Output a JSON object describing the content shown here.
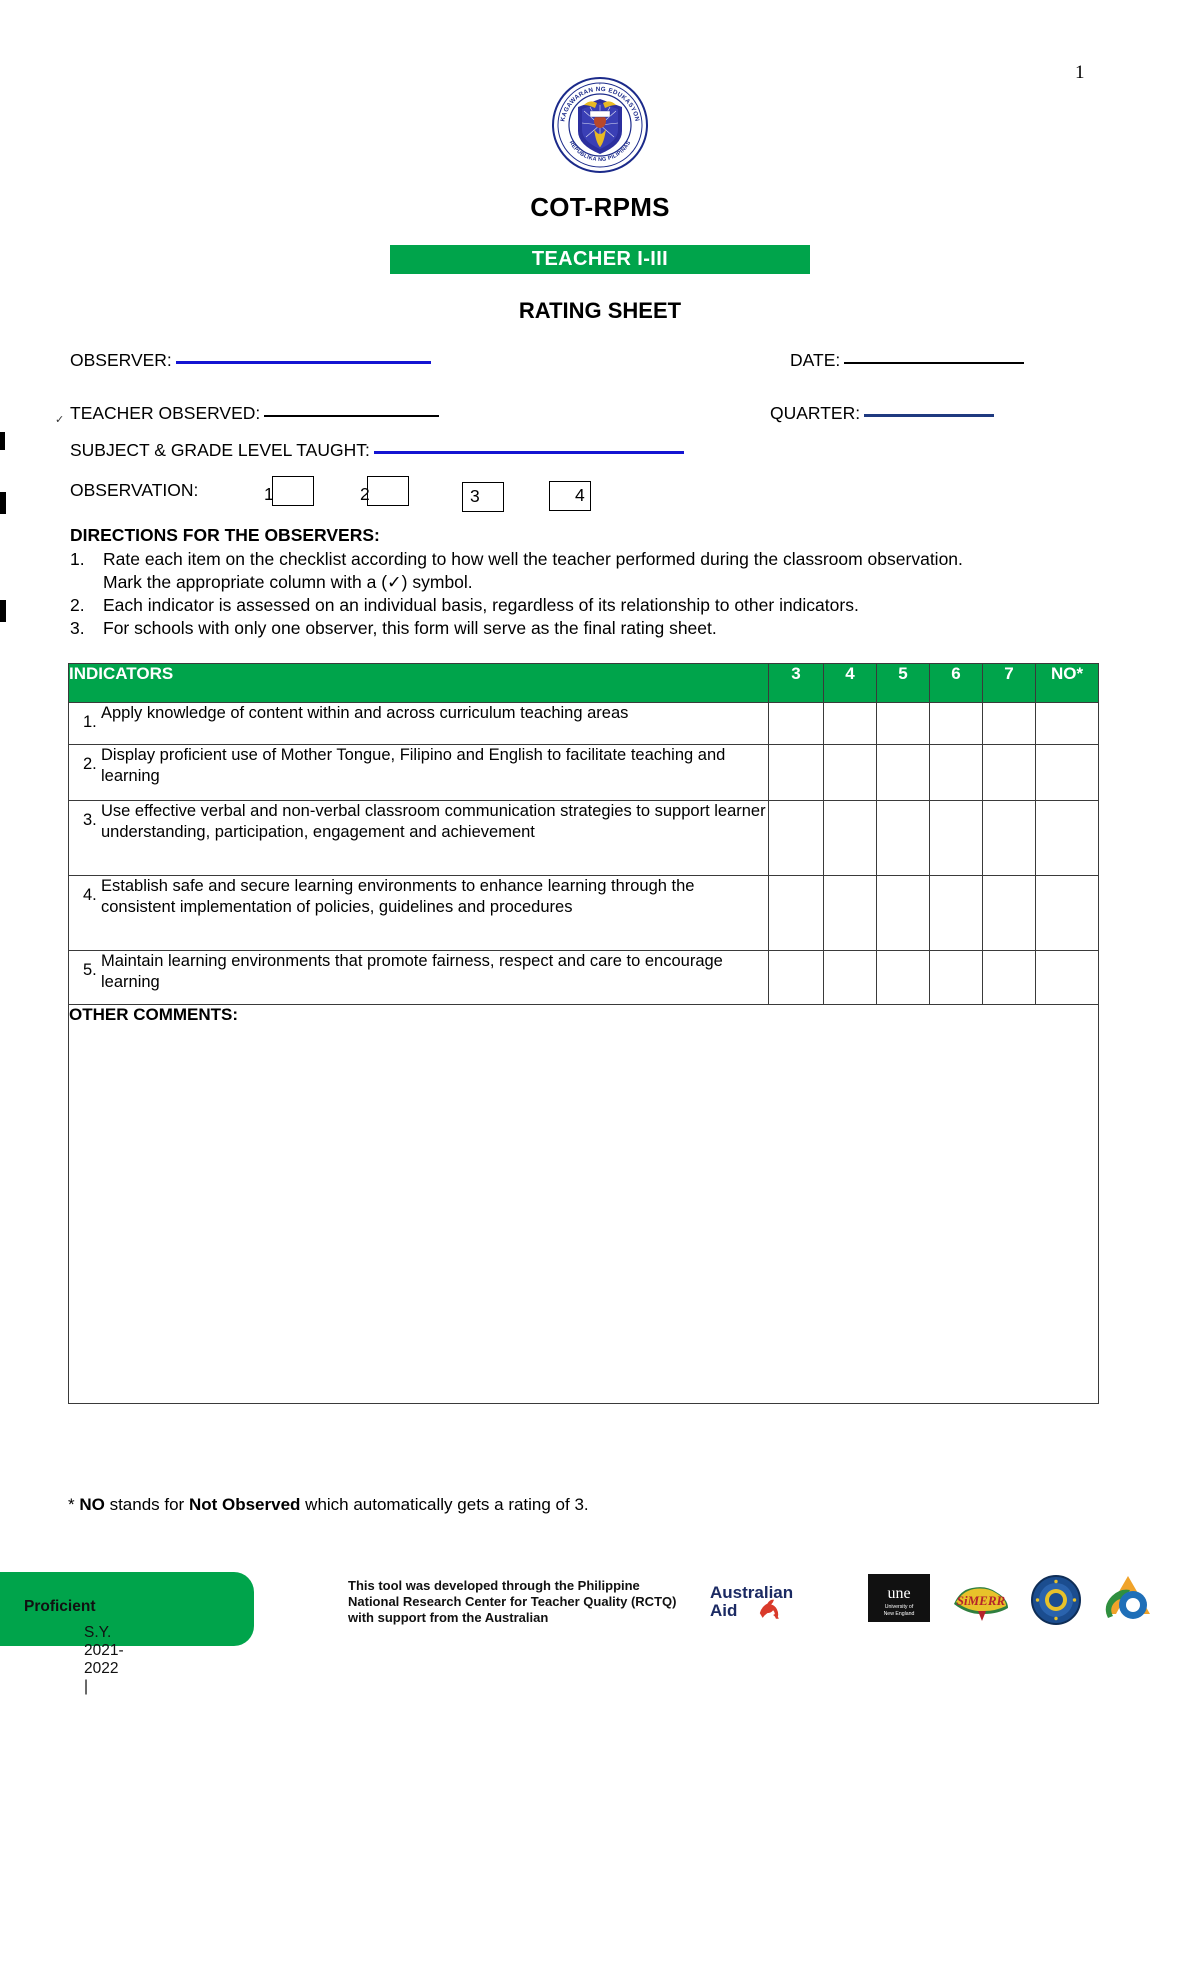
{
  "page": {
    "number": "1"
  },
  "header": {
    "logo_alt": "deped-seal-icon",
    "title": "COT-RPMS",
    "banner": "TEACHER I-III",
    "sheet_title": "RATING SHEET"
  },
  "form": {
    "observer_label": "OBSERVER:",
    "date_label": "DATE:",
    "teacher_observed_label": "TEACHER OBSERVED:",
    "quarter_label": "QUARTER:",
    "subject_grade_label": "SUBJECT & GRADE LEVEL TAUGHT:",
    "observation_label": "OBSERVATION:",
    "observation_options": [
      "1",
      "2",
      "3",
      "4"
    ],
    "observer_value": "",
    "date_value": "",
    "teacher_observed_value": "",
    "quarter_value": "",
    "subject_grade_value": ""
  },
  "directions": {
    "title": "DIRECTIONS FOR THE OBSERVERS:",
    "items": [
      {
        "num": "1.",
        "text": "Rate each item on the checklist according to how well the teacher performed during the classroom observation. Mark the appropriate column with a (✓) symbol."
      },
      {
        "num": "2.",
        "text": "Each indicator is assessed on an individual basis, regardless of its relationship to other indicators."
      },
      {
        "num": "3.",
        "text": "For schools with only one observer, this form will serve as the final rating sheet."
      }
    ]
  },
  "table": {
    "header": {
      "indicators": "INDICATORS",
      "scores": [
        "3",
        "4",
        "5",
        "6",
        "7",
        "NO*"
      ]
    },
    "rows": [
      {
        "num": "1.",
        "text": "Apply knowledge of content within and across curriculum teaching areas"
      },
      {
        "num": "2.",
        "text": "Display proficient use of Mother Tongue, Filipino and English to facilitate teaching and learning"
      },
      {
        "num": "3.",
        "text": "Use effective verbal and non-verbal classroom communication strategies to support learner understanding, participation, engagement and achievement"
      },
      {
        "num": "4.",
        "text": "Establish safe and secure learning environments to enhance learning through the consistent implementation of policies, guidelines and procedures"
      },
      {
        "num": "5.",
        "text": "Maintain learning environments that promote fairness, respect and care to encourage learning"
      }
    ],
    "comments_label": "OTHER COMMENTS:",
    "comments_value": ""
  },
  "footnote": {
    "prefix": "* ",
    "bold1": "NO",
    "mid1": " stands for ",
    "bold2": "Not Observed",
    "mid2": " which automatically gets a rating of 3."
  },
  "footer": {
    "sy_plain": "S.Y. 2021-2022 | ",
    "sy_bold": "Proficient",
    "credit": "This tool was developed through the Philippine National Research Center for Teacher Quality (RCTQ) with support from the Australian",
    "logos": [
      {
        "name": "australian-aid-logo",
        "line1": "Australian",
        "line2": "Aid"
      },
      {
        "name": "une-logo",
        "line1": "une",
        "line2": "University of",
        "line3": "New England"
      },
      {
        "name": "smerr-logo",
        "line1": "SiMERR"
      },
      {
        "name": "philippine-seal-logo",
        "line1": ""
      },
      {
        "name": "rctq-logo",
        "line1": ""
      }
    ]
  },
  "colors": {
    "brand_green": "#00a44b",
    "rule_blue": "#1414d2",
    "rule_navy": "#1f3a80",
    "table_border": "#3a3a3a"
  }
}
